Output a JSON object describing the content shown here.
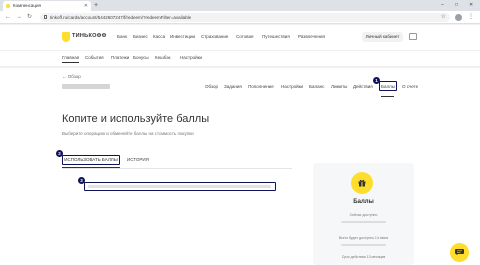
{
  "browser": {
    "tab_title": "Компенсация",
    "url": "tinkoff.ru/cards/account/5442607247/f/redeem/?redeemFilter=available"
  },
  "header": {
    "logo": "ТИНЬКОФФ",
    "nav": [
      "Банк",
      "Бизнес",
      "Касса",
      "Инвестиции",
      "Страхование",
      "Сотовая",
      "Путешествия",
      "Развлечения"
    ],
    "cabinet_button": "Личный кабинет"
  },
  "subnav": {
    "items": [
      "Главная",
      "События",
      "Платежи",
      "Бонусы",
      "Кешбэк",
      "Настройки"
    ]
  },
  "account": {
    "breadcrumb": "← Обзор",
    "tabs": [
      "Обзор",
      "Задания",
      "Пополнение",
      "Настройки",
      "Баланс",
      "Лимиты",
      "Действия",
      "Баллы",
      "О счете"
    ],
    "active_tab": "Баллы"
  },
  "page": {
    "title": "Копите и используйте баллы",
    "subtitle": "Выберите операцию и обменяйте баллы на стоимость покупки",
    "tab_use": "ИСПОЛЬЗОВАТЬ БАЛЛЫ",
    "tab_history": "ИСТОРИЯ"
  },
  "markers": {
    "m1": "1",
    "m2": "2",
    "m3": "3"
  },
  "balance_card": {
    "title": "Баллы",
    "line1": "Сейчас доступно",
    "line2": "Всего будет доступно 14 июня",
    "line3": "Срок действия 13 месяцев"
  },
  "icons": [
    "gift-icon",
    "chat-icon",
    "lock-icon",
    "star-icon"
  ],
  "colors": {
    "brand_yellow": "#ffdd2d",
    "highlight": "#10125a"
  }
}
